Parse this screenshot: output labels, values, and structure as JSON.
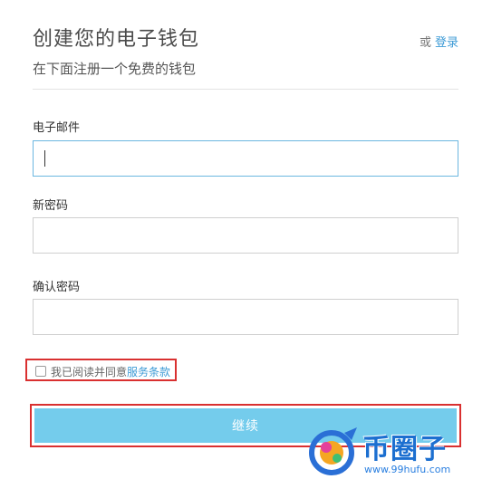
{
  "header": {
    "title": "创建您的电子钱包",
    "subtitle": "在下面注册一个免费的钱包",
    "or_text": "或",
    "login_label": "登录"
  },
  "form": {
    "email": {
      "label": "电子邮件",
      "value": ""
    },
    "password": {
      "label": "新密码",
      "value": ""
    },
    "confirm": {
      "label": "确认密码",
      "value": ""
    },
    "terms": {
      "checked": false,
      "text": "我已阅读并同意",
      "link": "服务条款"
    },
    "submit_label": "继续"
  },
  "watermark": {
    "name": "币圈子",
    "url": "www.99hufu.com"
  },
  "colors": {
    "accent": "#3d9bd6",
    "button": "#74ccec",
    "highlight": "#d93030",
    "watermark": "#1c6fd0"
  }
}
